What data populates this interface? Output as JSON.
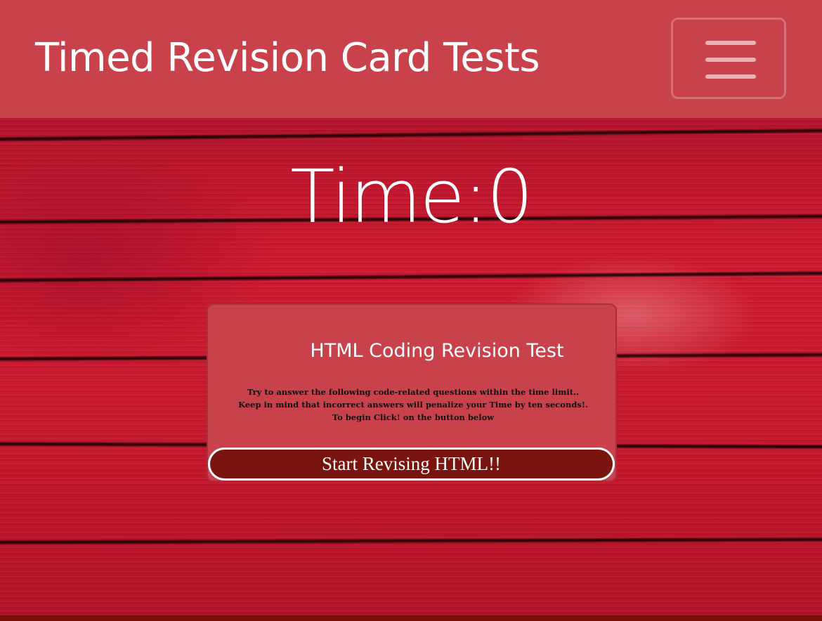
{
  "navbar": {
    "brand": "Timed Revision Card Tests",
    "menu_icon": "hamburger-menu-icon"
  },
  "timer": {
    "label": "Time:",
    "value": "0"
  },
  "card": {
    "title": "HTML Coding Revision Test",
    "lines": [
      "Try to answer the following code-related questions within the time limit..",
      "Keep in mind that incorrect answers will penalize your Time by ten seconds!.",
      "To begin Click! on the button below"
    ]
  },
  "start_button": {
    "label": "Start Revising HTML!!"
  },
  "colors": {
    "navbar": "#c9414a",
    "card": "#c9414a",
    "button": "#7a140e",
    "background": "#c8102e"
  }
}
